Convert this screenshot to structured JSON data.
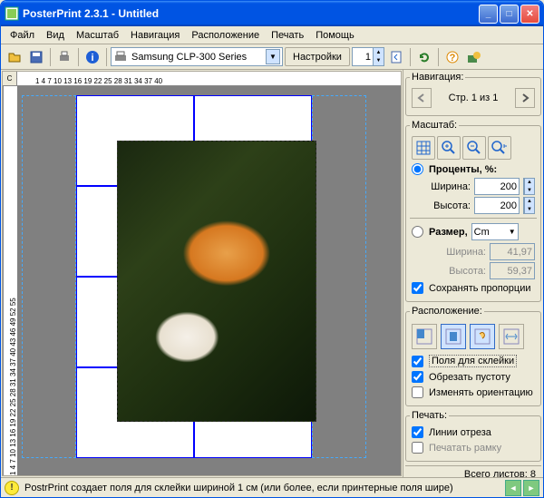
{
  "window": {
    "title": "PosterPrint 2.3.1 - Untitled"
  },
  "menu": [
    "Файл",
    "Вид",
    "Масштаб",
    "Навигация",
    "Расположение",
    "Печать",
    "Помощь"
  ],
  "toolbar": {
    "printer": "Samsung CLP-300 Series",
    "settings": "Настройки",
    "copies": "1"
  },
  "ruler_top": "1  4  7  10  13  16  19  22  25  28  31  34  37  40",
  "ruler_left": "1  4  7  10  13  16  19  22  25  28  31  34  37  40  43  46  49  52  55",
  "corner": "C",
  "sidebar": {
    "nav": {
      "title": "Навигация:",
      "page": "Стр. 1 из 1"
    },
    "scale": {
      "title": "Масштаб:",
      "percent_label": "Проценты, %:",
      "width_label": "Ширина:",
      "width_val": "200",
      "height_label": "Высота:",
      "height_val": "200",
      "size_label": "Размер,",
      "unit": "Cm",
      "size_w_label": "Ширина:",
      "size_w_val": "41,97",
      "size_h_label": "Высота:",
      "size_h_val": "59,37",
      "keep_aspect": "Сохранять пропорции"
    },
    "placement": {
      "title": "Расположение:",
      "glue": "Поля для склейки",
      "crop_empty": "Обрезать пустоту",
      "rotate": "Изменять ориентацию"
    },
    "print": {
      "title": "Печать:",
      "cutlines": "Линии отреза",
      "frame": "Печатать рамку"
    },
    "total": "Всего листов: 8"
  },
  "status": {
    "text": "PostrPrint создает поля для склейки шириной 1 см (или более, если принтерные поля шире)"
  }
}
